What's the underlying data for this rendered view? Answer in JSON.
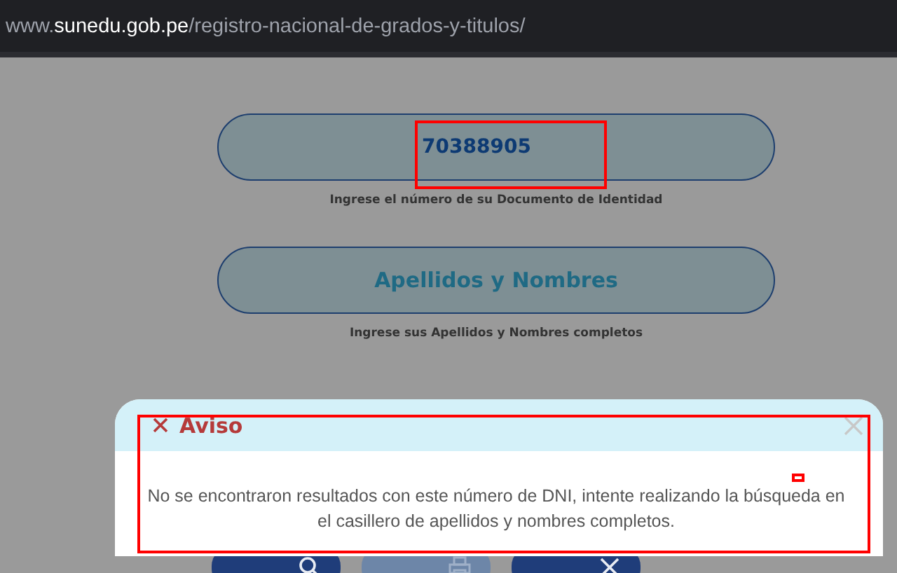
{
  "address_bar": {
    "domain_prefix": "www.",
    "domain": "sunedu.gob.pe",
    "path": "/registro-nacional-de-grados-y-titulos/"
  },
  "fields": [
    {
      "value": "70388905",
      "hint": "Ingrese el número de su Documento de Identidad"
    },
    {
      "placeholder": "Apellidos y Nombres",
      "hint": "Ingrese sus Apellidos y Nombres completos"
    }
  ],
  "buttons": [
    {
      "disabled": false
    },
    {
      "disabled": true
    },
    {
      "disabled": false
    }
  ],
  "dialog": {
    "title": "Aviso",
    "message": "No se encontraron resultados con este número de DNI, intente realizando la búsqueda en el casillero de apellidos y nombres completos."
  }
}
